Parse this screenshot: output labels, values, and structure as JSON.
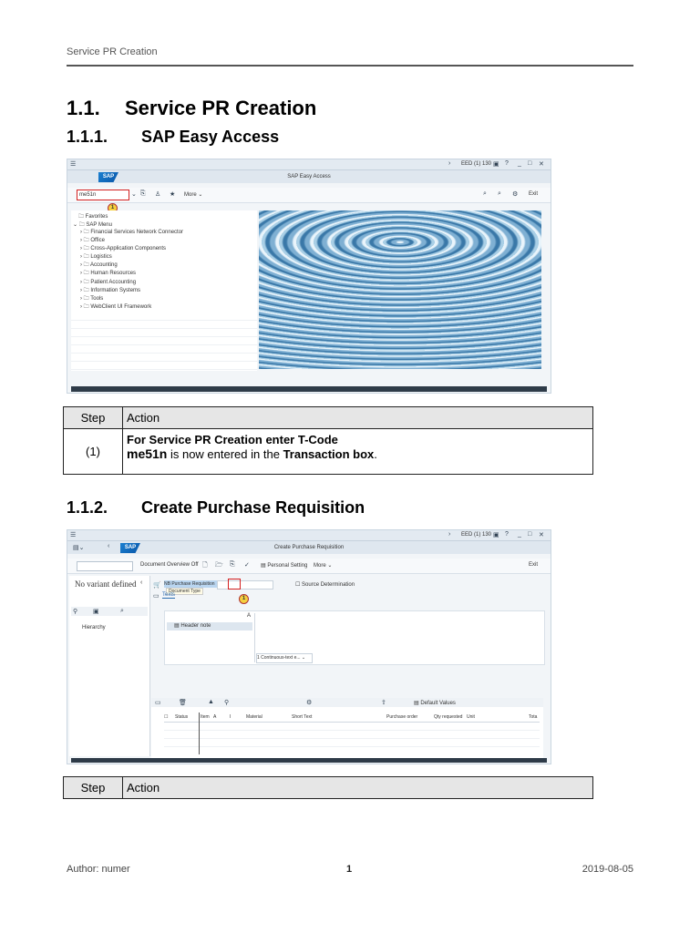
{
  "header": {
    "running_title": "Service PR Creation"
  },
  "section": {
    "number": "1.1.",
    "title": "Service PR Creation"
  },
  "sub1": {
    "number": "1.1.1.",
    "title": "SAP Easy Access"
  },
  "shot1": {
    "window_title": "SAP Easy Access",
    "system_info": "EED (1) 130",
    "sap_logo": "SAP",
    "tcode_value": "me51n",
    "more_label": "More",
    "exit_label": "Exit",
    "marker": "1",
    "favorites": "Favorites",
    "sap_menu": "SAP Menu",
    "menu_items": [
      "Financial Services Network Connector",
      "Office",
      "Cross-Application Components",
      "Logistics",
      "Accounting",
      "Human Resources",
      "Patient Accounting",
      "Information Systems",
      "Tools",
      "WebClient UI Framework"
    ]
  },
  "table1": {
    "col_step": "Step",
    "col_action": "Action",
    "row_step": "(1)",
    "line1": "For Service PR Creation enter T-Code",
    "tcode": "me51n",
    "line2_mid": " is now entered in the ",
    "line2_bold": "Transaction box",
    "line2_end": "."
  },
  "sub2": {
    "number": "1.1.2.",
    "title": "Create Purchase Requisition"
  },
  "shot2": {
    "window_title": "Create Purchase Requisition",
    "system_info": "EED (1) 130",
    "sap_logo": "SAP",
    "doc_overview": "Document Overview Off",
    "personal_setting": "Personal Setting",
    "more_label": "More",
    "exit_label": "Exit",
    "no_variant": "No variant defined",
    "hierarchy": "Hierarchy",
    "doc_type_value": "NB Purchase Requisition",
    "doc_type_tooltip": "Document Type",
    "source_det": "Source Determination",
    "texts_tab": "Texts",
    "header_note": "Header note",
    "col_a": "A",
    "continuous_text": "1 Continuous-text e...",
    "default_values": "Default Values",
    "marker": "1",
    "item_columns": [
      "Status",
      "Item",
      "A",
      "I",
      "Material",
      "Short Text",
      "Purchase order",
      "Qty requested",
      "Unit",
      "Tota"
    ]
  },
  "table2": {
    "col_step": "Step",
    "col_action": "Action"
  },
  "footer": {
    "author": "Author: numer",
    "page": "1",
    "date": "2019-08-05"
  }
}
